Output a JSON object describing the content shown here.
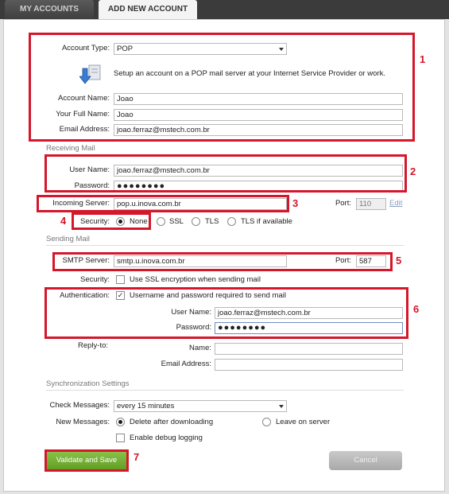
{
  "tabs": [
    {
      "label": "MY ACCOUNTS",
      "active": false
    },
    {
      "label": "ADD NEW ACCOUNT",
      "active": true
    }
  ],
  "account": {
    "type_label": "Account Type:",
    "type_value": "POP",
    "description": "Setup an account on a POP mail server at your Internet Service Provider or work.",
    "name_label": "Account Name:",
    "name_value": "Joao",
    "fullname_label": "Your Full Name:",
    "fullname_value": "Joao",
    "email_label": "Email Address:",
    "email_value": "joao.ferraz@mstech.com.br"
  },
  "receiving": {
    "section_title": "Receiving Mail",
    "username_label": "User Name:",
    "username_value": "joao.ferraz@mstech.com.br",
    "password_label": "Password:",
    "password_value": "●●●●●●●●",
    "server_label": "Incoming Server:",
    "server_value": "pop.u.inova.com.br",
    "port_label": "Port:",
    "port_value": "110",
    "edit_label": "Edit",
    "security_label": "Security:",
    "security_options": [
      {
        "label": "None",
        "selected": true
      },
      {
        "label": "SSL",
        "selected": false
      },
      {
        "label": "TLS",
        "selected": false
      },
      {
        "label": "TLS if available",
        "selected": false
      }
    ]
  },
  "sending": {
    "section_title": "Sending Mail",
    "smtp_label": "SMTP Server:",
    "smtp_value": "smtp.u.inova.com.br",
    "port_label": "Port:",
    "port_value": "587",
    "security_label": "Security:",
    "ssl_checkbox_label": "Use SSL encryption when sending mail",
    "ssl_checked": false,
    "auth_label": "Authentication:",
    "auth_checkbox_label": "Username and password required to send mail",
    "auth_checked": true,
    "auth_username_label": "User Name:",
    "auth_username_value": "joao.ferraz@mstech.com.br",
    "auth_password_label": "Password:",
    "auth_password_value": "●●●●●●●●",
    "replyto_label": "Reply-to:",
    "replyto_name_label": "Name:",
    "replyto_name_value": "",
    "replyto_email_label": "Email Address:",
    "replyto_email_value": ""
  },
  "sync": {
    "section_title": "Synchronization Settings",
    "check_label": "Check Messages:",
    "check_value": "every 15 minutes",
    "new_label": "New Messages:",
    "delete_option": "Delete after downloading",
    "delete_selected": true,
    "leave_option": "Leave on server",
    "leave_selected": false,
    "debug_label": "Enable debug logging",
    "debug_checked": false
  },
  "buttons": {
    "validate_label": "Validate and Save",
    "cancel_label": "Cancel"
  },
  "annotations": [
    "1",
    "2",
    "3",
    "4",
    "5",
    "6",
    "7"
  ],
  "colors": {
    "annotation_red": "#d4172b",
    "validate_green": "#6aaa2a",
    "tab_bar": "#3b3b3b"
  }
}
